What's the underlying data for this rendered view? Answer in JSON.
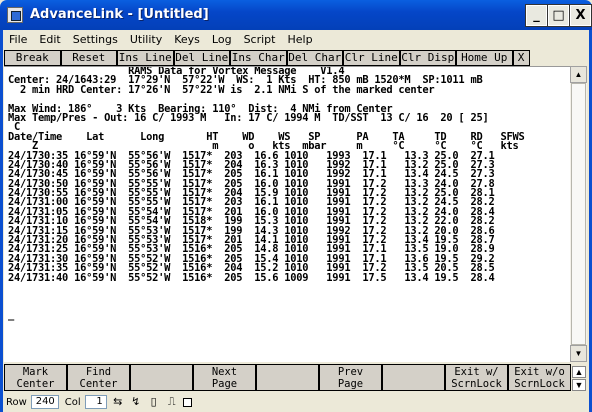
{
  "window": {
    "title": "AdvanceLink - [Untitled]",
    "minimize": "_",
    "maximize": "□",
    "close": "X"
  },
  "menu": [
    "File",
    "Edit",
    "Settings",
    "Utility",
    "Keys",
    "Log",
    "Script",
    "Help"
  ],
  "toolbar": [
    "Break",
    "Reset",
    "Ins Line",
    "Del Line",
    "Ins Char",
    "Del Char",
    "Clr Line",
    "Clr Disp",
    "Home Up",
    "X"
  ],
  "terminal": {
    "lines": [
      "                    RAMS Data for Vortex Message    V1.4",
      "Center: 24/1643:29  17°29'N  57°22'W  WS:  1 Kts  HT: 850 mB 1520*M  SP:1011 mB",
      "  2 min HRD Center: 17°26'N  57°22'W is  2.1 NMi S of the marked center",
      "",
      "Max Wind: 186°    3 Kts  Bearing: 110°  Dist:  4 NMi from Center",
      "Max Temp/Pres - Out: 16 C/ 1993 M   In: 17 C/ 1994 M  TD/SST  13 C/ 16  20 [ 25]",
      " C",
      "Date/Time    Lat      Long       HT    WD    WS   SP      PA    TA     TD    RD   SFWS",
      "    Z                             m     o   kts  mbar     m     °C     °C    °C   kts",
      "24/1730:35 16°59'N  55°56'W  1517*  203  16.6 1010   1993  17.1   13.3 25.0  27.1",
      "24/1730:40 16°59'N  55°56'W  1517*  204  16.3 1010   1992  17.1   13.2 25.0  27.3",
      "24/1730:45 16°59'N  55°56'W  1517*  205  16.1 1010   1992  17.1   13.4 24.5  27.3",
      "24/1730:50 16°59'N  55°55'W  1517*  205  16.0 1010   1991  17.2   13.3 24.0  27.8",
      "24/1730:55 16°59'N  55°55'W  1517*  204  15.9 1010   1991  17.2   13.2 25.0  28.1",
      "24/1731:00 16°59'N  55°55'W  1517*  203  16.1 1010   1991  17.2   13.2 24.5  28.2",
      "24/1731:05 16°59'N  55°54'W  1517*  201  16.0 1010   1991  17.2   13.2 24.0  28.4",
      "24/1731:10 16°59'N  55°54'W  1518*  199  15.3 1010   1991  17.2   13.2 22.0  28.2",
      "24/1731:15 16°59'N  55°53'W  1517*  199  14.3 1010   1992  17.2   13.2 20.0  28.6",
      "24/1731:20 16°59'N  55°53'W  1517*  201  14.1 1010   1991  17.2   13.4 19.5  28.7",
      "24/1731:25 16°59'N  55°53'W  1516*  205  14.8 1010   1991  17.1   13.5 19.0  28.9",
      "24/1731:30 16°59'N  55°52'W  1516*  205  15.4 1010   1991  17.1   13.6 19.5  29.2",
      "24/1731:35 16°59'N  55°52'W  1516*  204  15.2 1010   1991  17.2   13.5 20.5  28.5",
      "24/1731:40 16°59'N  55°52'W  1516*  205  15.6 1009   1991  17.5   13.4 19.5  28.4",
      "",
      "",
      "",
      "_"
    ]
  },
  "fkeys": [
    "Mark\nCenter",
    "Find\nCenter",
    "",
    "Next\nPage",
    "",
    "Prev\nPage",
    "",
    "Exit w/\nScrnLock",
    "Exit w/o\nScrnLock"
  ],
  "status": {
    "row_label": "Row",
    "row_value": "240",
    "col_label": "Col",
    "col_value": "1"
  }
}
